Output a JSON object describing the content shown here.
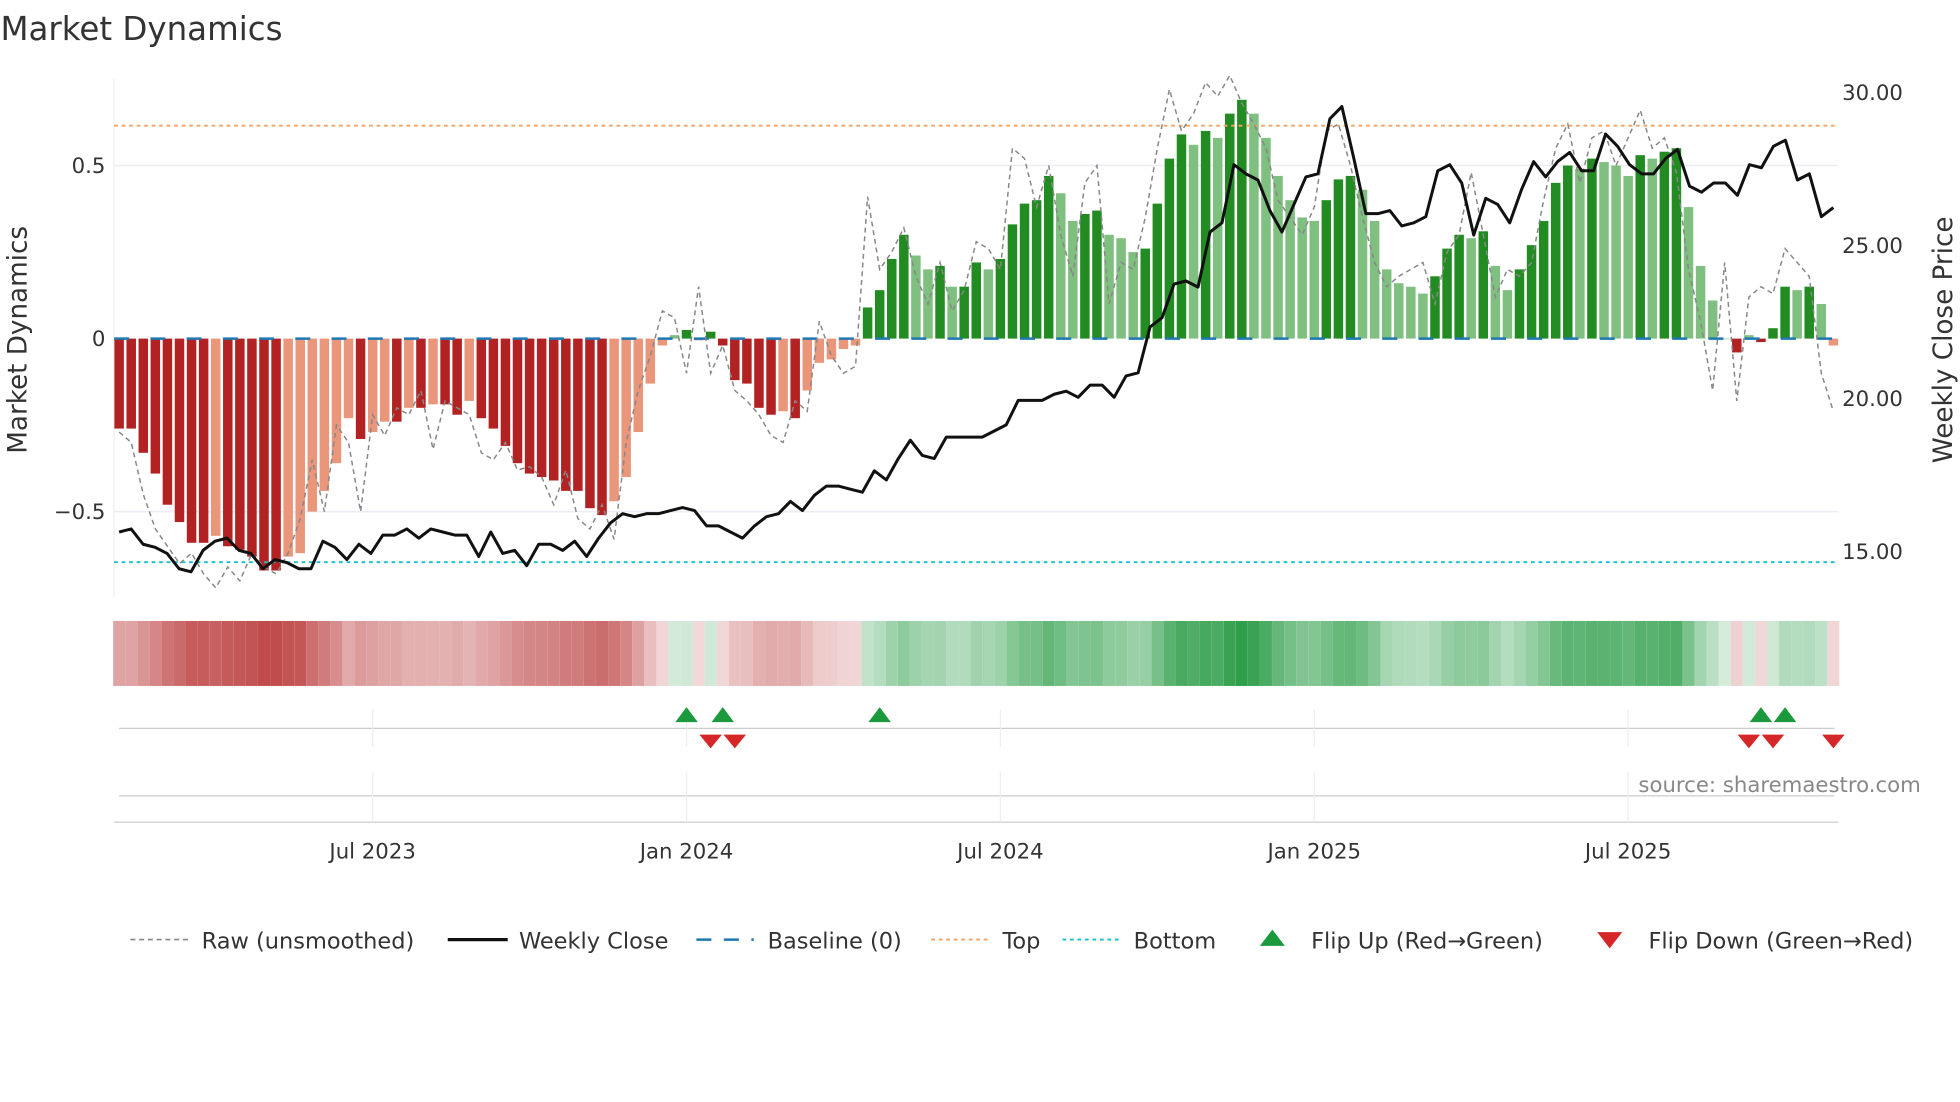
{
  "chart_data": {
    "type": "bar",
    "title": "Market Dynamics",
    "ylabel_left": "Market Dynamics",
    "ylabel_right": "Weekly Close Price",
    "ylim_left": [
      -0.75,
      0.75
    ],
    "ylim_right": [
      12.6,
      31.2
    ],
    "left_ticks": [
      {
        "v": 0.5,
        "label": "0.5"
      },
      {
        "v": 0,
        "label": "0"
      },
      {
        "v": -0.5,
        "label": "−0.5"
      }
    ],
    "right_ticks": [
      {
        "v": 30,
        "label": "30.00"
      },
      {
        "v": 25,
        "label": "25.00"
      },
      {
        "v": 20,
        "label": "20.00"
      },
      {
        "v": 15,
        "label": "15.00"
      }
    ],
    "x_ticks": [
      {
        "week": 21,
        "label": "Jul 2023"
      },
      {
        "week": 47,
        "label": "Jan 2024"
      },
      {
        "week": 73,
        "label": "Jul 2024"
      },
      {
        "week": 99,
        "label": "Jan 2025"
      },
      {
        "week": 125,
        "label": "Jul 2025"
      }
    ],
    "top_level": 0.615,
    "bottom_level": -0.646,
    "baseline": 0,
    "momentum": [
      -0.26,
      -0.26,
      -0.33,
      -0.39,
      -0.48,
      -0.53,
      -0.59,
      -0.59,
      -0.57,
      -0.6,
      -0.61,
      -0.63,
      -0.67,
      -0.67,
      -0.63,
      -0.62,
      -0.5,
      -0.44,
      -0.36,
      -0.23,
      -0.29,
      -0.27,
      -0.24,
      -0.24,
      -0.2,
      -0.2,
      -0.19,
      -0.19,
      -0.22,
      -0.18,
      -0.23,
      -0.26,
      -0.31,
      -0.36,
      -0.39,
      -0.4,
      -0.41,
      -0.44,
      -0.44,
      -0.49,
      -0.51,
      -0.47,
      -0.4,
      -0.27,
      -0.13,
      -0.02,
      0.01,
      0.025,
      -0.005,
      0.02,
      -0.02,
      -0.12,
      -0.13,
      -0.2,
      -0.22,
      -0.21,
      -0.23,
      -0.15,
      -0.07,
      -0.06,
      -0.03,
      -0.02,
      0.09,
      0.14,
      0.23,
      0.3,
      0.24,
      0.2,
      0.21,
      0.15,
      0.15,
      0.22,
      0.2,
      0.23,
      0.33,
      0.39,
      0.4,
      0.47,
      0.42,
      0.34,
      0.36,
      0.37,
      0.3,
      0.29,
      0.25,
      0.26,
      0.39,
      0.52,
      0.59,
      0.56,
      0.6,
      0.58,
      0.65,
      0.69,
      0.65,
      0.58,
      0.47,
      0.4,
      0.35,
      0.34,
      0.4,
      0.46,
      0.47,
      0.43,
      0.34,
      0.2,
      0.16,
      0.15,
      0.13,
      0.18,
      0.26,
      0.3,
      0.29,
      0.31,
      0.21,
      0.14,
      0.2,
      0.27,
      0.34,
      0.45,
      0.5,
      0.49,
      0.52,
      0.51,
      0.5,
      0.47,
      0.53,
      0.52,
      0.54,
      0.55,
      0.38,
      0.21,
      0.11,
      0.0,
      -0.04,
      0.01,
      -0.01,
      0.03,
      0.15,
      0.14,
      0.15,
      0.1,
      -0.02
    ],
    "raw": [
      -0.27,
      -0.3,
      -0.45,
      -0.55,
      -0.6,
      -0.65,
      -0.62,
      -0.68,
      -0.72,
      -0.66,
      -0.7,
      -0.62,
      -0.66,
      -0.68,
      -0.62,
      -0.52,
      -0.35,
      -0.5,
      -0.25,
      -0.3,
      -0.5,
      -0.22,
      -0.28,
      -0.2,
      -0.22,
      -0.15,
      -0.32,
      -0.18,
      -0.2,
      -0.22,
      -0.33,
      -0.35,
      -0.3,
      -0.38,
      -0.37,
      -0.4,
      -0.48,
      -0.38,
      -0.52,
      -0.55,
      -0.48,
      -0.58,
      -0.3,
      -0.15,
      -0.05,
      0.08,
      0.06,
      -0.1,
      0.15,
      -0.1,
      -0.02,
      -0.15,
      -0.18,
      -0.22,
      -0.28,
      -0.3,
      -0.18,
      -0.21,
      0.05,
      -0.05,
      -0.1,
      -0.08,
      0.41,
      0.2,
      0.25,
      0.32,
      0.18,
      0.1,
      0.22,
      0.08,
      0.14,
      0.28,
      0.26,
      0.2,
      0.55,
      0.52,
      0.38,
      0.5,
      0.3,
      0.18,
      0.45,
      0.5,
      0.1,
      0.22,
      0.2,
      0.35,
      0.55,
      0.72,
      0.6,
      0.65,
      0.74,
      0.7,
      0.76,
      0.68,
      0.62,
      0.55,
      0.4,
      0.35,
      0.3,
      0.38,
      0.6,
      0.62,
      0.5,
      0.35,
      0.22,
      0.15,
      0.18,
      0.2,
      0.22,
      0.1,
      0.25,
      0.3,
      0.48,
      0.3,
      0.12,
      0.2,
      0.18,
      0.22,
      0.4,
      0.55,
      0.62,
      0.45,
      0.58,
      0.6,
      0.5,
      0.58,
      0.66,
      0.55,
      0.58,
      0.48,
      0.2,
      0.05,
      -0.15,
      0.22,
      -0.18,
      0.12,
      0.15,
      0.13,
      0.26,
      0.22,
      0.18,
      -0.1,
      -0.21
    ],
    "weekly_close": [
      15.6,
      15.7,
      15.2,
      15.1,
      14.9,
      14.4,
      14.3,
      15.0,
      15.3,
      15.4,
      15.0,
      14.9,
      14.4,
      14.7,
      14.6,
      14.4,
      14.4,
      15.3,
      15.1,
      14.7,
      15.2,
      14.9,
      15.5,
      15.5,
      15.7,
      15.4,
      15.7,
      15.6,
      15.5,
      15.5,
      14.8,
      15.6,
      14.9,
      15.0,
      14.5,
      15.2,
      15.2,
      15.0,
      15.3,
      14.8,
      15.4,
      15.9,
      16.2,
      16.1,
      16.2,
      16.2,
      16.3,
      16.4,
      16.3,
      15.8,
      15.8,
      15.6,
      15.4,
      15.8,
      16.1,
      16.2,
      16.6,
      16.3,
      16.8,
      17.1,
      17.1,
      17.0,
      16.9,
      17.6,
      17.3,
      18.0,
      18.6,
      18.1,
      18.0,
      18.7,
      18.7,
      18.7,
      18.7,
      18.9,
      19.1,
      19.9,
      19.9,
      19.9,
      20.1,
      20.2,
      20.0,
      20.4,
      20.4,
      20.0,
      20.7,
      20.8,
      22.3,
      22.6,
      23.7,
      23.8,
      23.6,
      25.4,
      25.7,
      27.6,
      27.3,
      27.1,
      26.1,
      25.4,
      26.3,
      27.2,
      27.3,
      29.1,
      29.5,
      27.8,
      26.0,
      26.0,
      26.1,
      25.6,
      25.7,
      25.9,
      27.4,
      27.6,
      27.0,
      25.3,
      26.5,
      26.3,
      25.7,
      26.8,
      27.7,
      27.2,
      27.7,
      28.0,
      27.4,
      27.4,
      28.6,
      28.2,
      27.6,
      27.3,
      27.3,
      27.8,
      28.1,
      26.9,
      26.7,
      27.0,
      27.0,
      26.6,
      27.6,
      27.5,
      28.2,
      28.4,
      27.1,
      27.3,
      25.9,
      26.2
    ],
    "flip_up_weeks": [
      47,
      50,
      63,
      136,
      138
    ],
    "flip_down_weeks": [
      49,
      51,
      135,
      137,
      142
    ],
    "legend": [
      {
        "key": "raw",
        "label": "Raw (unsmoothed)"
      },
      {
        "key": "close",
        "label": "Weekly Close"
      },
      {
        "key": "baseline",
        "label": "Baseline (0)"
      },
      {
        "key": "top",
        "label": "Top"
      },
      {
        "key": "bottom",
        "label": "Bottom"
      },
      {
        "key": "up",
        "label": "Flip Up (Red→Green)"
      },
      {
        "key": "down",
        "label": "Flip Down (Green→Red)"
      }
    ],
    "legend_placement": "bottom",
    "source": "source: sharemaestro.com",
    "colors": {
      "pos_strong": "#228b22",
      "pos_weak": "#7fbf7f",
      "neg_strong": "#b22222",
      "neg_weak": "#e9967a",
      "baseline": "#1f77b4",
      "top": "#f4a460",
      "bottom": "#17becf",
      "close": "#111111",
      "raw": "#888888",
      "flip_up": "#1a9a3c",
      "flip_down": "#d62728"
    }
  }
}
